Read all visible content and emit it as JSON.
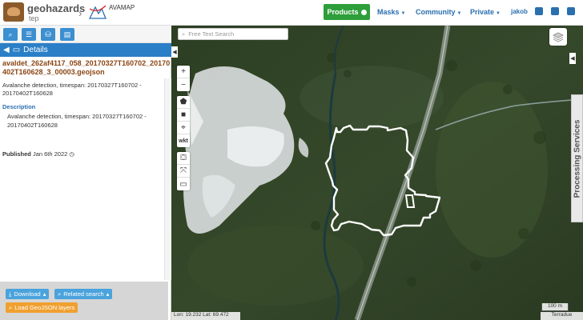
{
  "header": {
    "brand": "geohazards",
    "brand_sub": "tep",
    "app_name": "AVAMAP",
    "nav": {
      "products": "Products",
      "masks": "Masks",
      "community": "Community",
      "private": "Private",
      "user": "jakob"
    }
  },
  "colors": {
    "products_bg": "#2e9e3a",
    "nav_link": "#2a6fb0",
    "details_bar": "#2a7fc7",
    "file_title": "#8b4513",
    "btn_blue": "#4aa3dc",
    "btn_orange": "#f0a030",
    "polygon": "#ffffff"
  },
  "left_panel": {
    "toolbar_icons": [
      "search-icon",
      "list-icon",
      "basket-icon",
      "archive-icon"
    ],
    "details_label": "Details",
    "file_title": "avaldet_262af4117_058_20170327T160702_20170402T160628_3_00003.geojson",
    "summary": "Avalanche detection, timespan: 20170327T160702 - 20170402T160628",
    "description_heading": "Description",
    "description_text": "Avalanche detection, timespan: 20170327T160702 - 20170402T160628",
    "published_label": "Published",
    "published_date": "Jan 6th 2022",
    "buttons": {
      "download": "Download",
      "related_search": "Related search",
      "load_geojson": "Load GeoJSON layers"
    }
  },
  "map": {
    "search_placeholder": "Free Text Search",
    "wkt_label": "wkt",
    "processing_services": "Processing Services",
    "scale": "100 m",
    "coords": "Lon: 19.232  Lat: 69.472",
    "attribution": "Terradue"
  }
}
